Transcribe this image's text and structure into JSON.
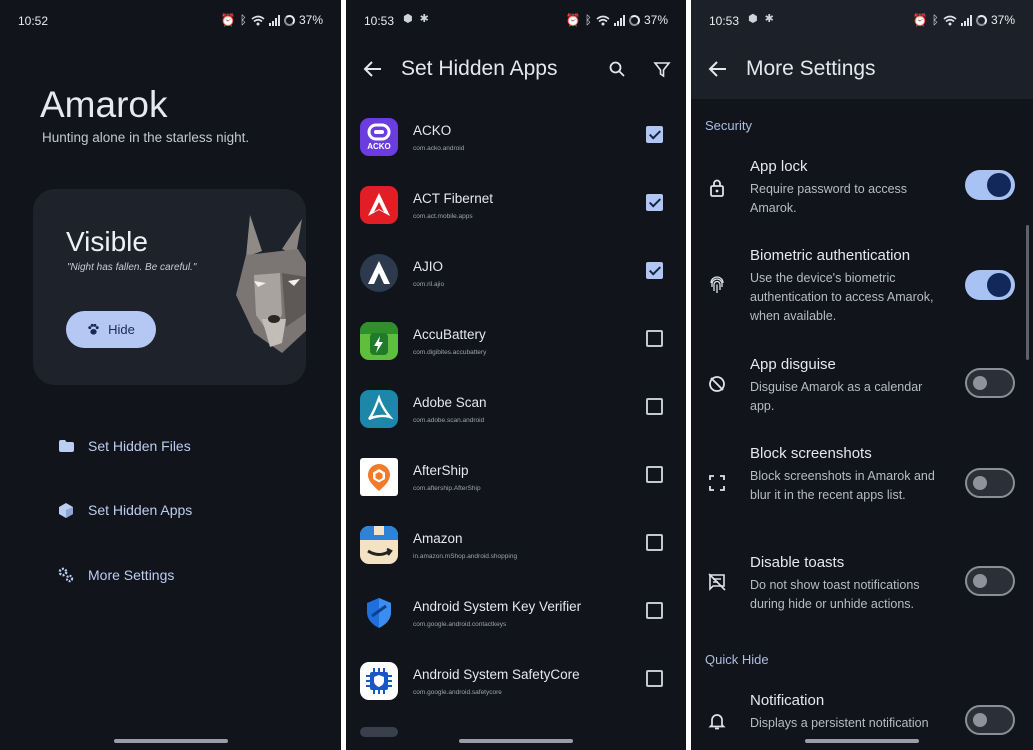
{
  "status_bars": [
    {
      "time": "10:52",
      "battery": "37%"
    },
    {
      "time": "10:53",
      "battery": "37%"
    },
    {
      "time": "10:53",
      "battery": "37%"
    }
  ],
  "home": {
    "app_name": "Amarok",
    "tagline": "Hunting alone in the starless night.",
    "status_card": {
      "state": "Visible",
      "quote": "\"Night has fallen. Be careful.\"",
      "hide_button": "Hide"
    },
    "menu": [
      {
        "label": "Set Hidden Files",
        "icon": "folder-icon"
      },
      {
        "label": "Set Hidden Apps",
        "icon": "cube-icon"
      },
      {
        "label": "More Settings",
        "icon": "gears-icon"
      }
    ]
  },
  "hidden_apps": {
    "title": "Set Hidden Apps",
    "apps": [
      {
        "name": "ACKO",
        "package": "com.acko.android",
        "checked": true
      },
      {
        "name": "ACT Fibernet",
        "package": "com.act.mobile.apps",
        "checked": true
      },
      {
        "name": "AJIO",
        "package": "com.ril.ajio",
        "checked": true
      },
      {
        "name": "AccuBattery",
        "package": "com.digibites.accubattery",
        "checked": false
      },
      {
        "name": "Adobe Scan",
        "package": "com.adobe.scan.android",
        "checked": false
      },
      {
        "name": "AfterShip",
        "package": "com.aftership.AfterShip",
        "checked": false
      },
      {
        "name": "Amazon",
        "package": "in.amazon.mShop.android.shopping",
        "checked": false
      },
      {
        "name": "Android System Key Verifier",
        "package": "com.google.android.contactkeys",
        "checked": false
      },
      {
        "name": "Android System SafetyCore",
        "package": "com.google.android.safetycore",
        "checked": false
      }
    ],
    "icon_label_acko": "ACKO"
  },
  "more_settings": {
    "title": "More Settings",
    "sections": [
      {
        "label": "Security",
        "items": [
          {
            "title": "App lock",
            "desc": "Require password to access Amarok.",
            "on": true,
            "icon": "lock-icon"
          },
          {
            "title": "Biometric authentication",
            "desc": "Use the device's biometric authentication to access Amarok, when available.",
            "on": true,
            "icon": "fingerprint-icon"
          },
          {
            "title": "App disguise",
            "desc": "Disguise Amarok as a calendar app.",
            "on": false,
            "icon": "disguise-icon"
          },
          {
            "title": "Block screenshots",
            "desc": "Block screenshots in Amarok and blur it in the recent apps list.",
            "on": false,
            "icon": "screenshot-icon"
          },
          {
            "title": "Disable toasts",
            "desc": "Do not show toast notifications during hide or unhide actions.",
            "on": false,
            "icon": "toast-off-icon"
          }
        ]
      },
      {
        "label": "Quick Hide",
        "items": [
          {
            "title": "Notification",
            "desc": "Displays a persistent notification",
            "on": false,
            "icon": "bell-icon"
          }
        ]
      }
    ]
  }
}
